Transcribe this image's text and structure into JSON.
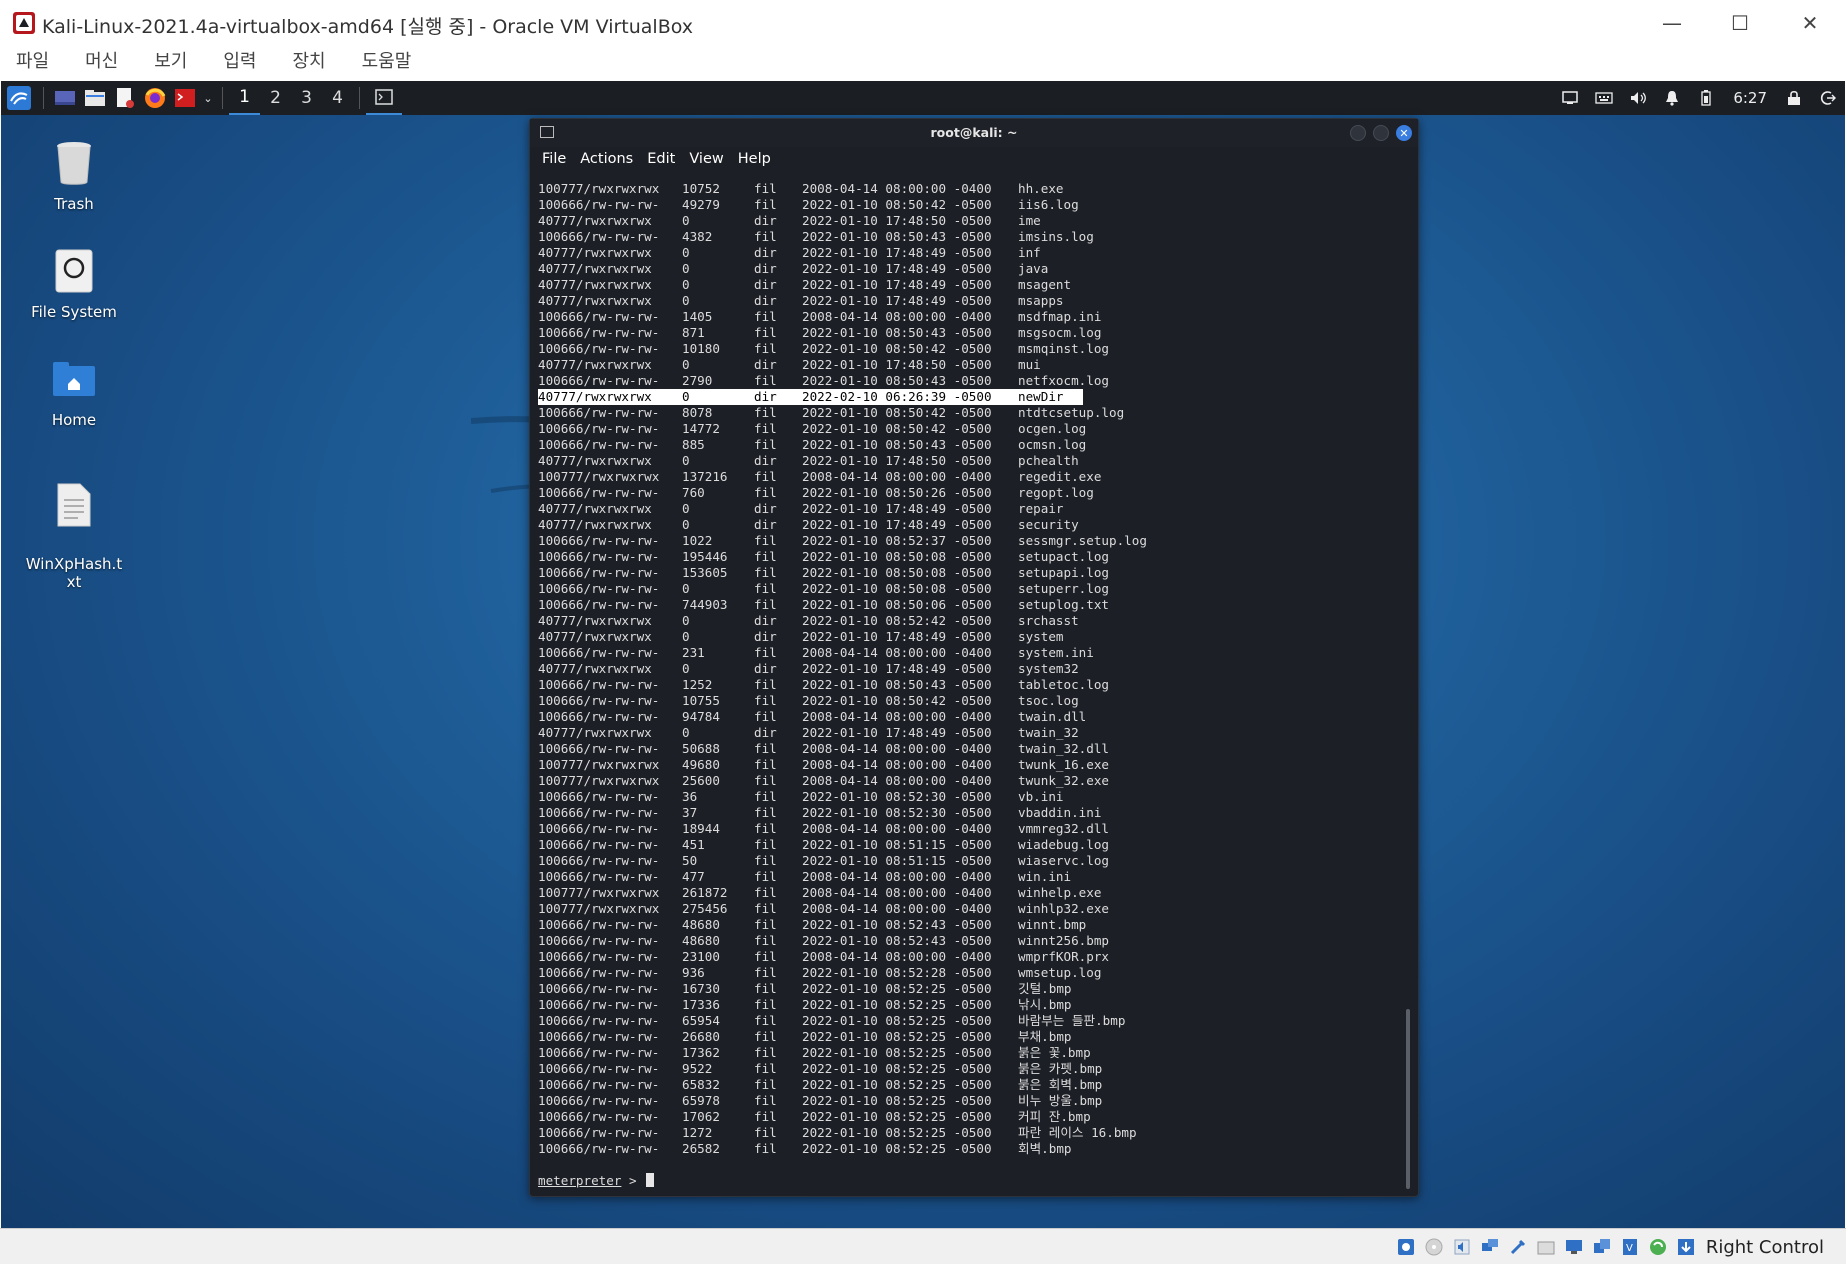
{
  "vbox": {
    "title": "Kali-Linux-2021.4a-virtualbox-amd64 [실행 중] - Oracle VM VirtualBox",
    "menu": [
      "파일",
      "머신",
      "보기",
      "입력",
      "장치",
      "도움말"
    ],
    "host_key": "Right Control"
  },
  "panel": {
    "workspaces": [
      "1",
      "2",
      "3",
      "4"
    ],
    "clock": "6:27"
  },
  "desktop": {
    "icons": [
      {
        "label": "Trash"
      },
      {
        "label": "File System"
      },
      {
        "label": "Home"
      },
      {
        "label": "WinXpHash.t\nxt"
      }
    ]
  },
  "terminal": {
    "title": "root@kali: ~",
    "menu": [
      "File",
      "Actions",
      "Edit",
      "View",
      "Help"
    ],
    "prompt": "meterpreter",
    "prompt_suffix": " > ",
    "highlighted_row": 13,
    "rows": [
      [
        "100777/rwxrwxrwx",
        "10752",
        "fil",
        "2008-04-14 08:00:00 -0400",
        "hh.exe"
      ],
      [
        "100666/rw-rw-rw-",
        "49279",
        "fil",
        "2022-01-10 08:50:42 -0500",
        "iis6.log"
      ],
      [
        "40777/rwxrwxrwx",
        "0",
        "dir",
        "2022-01-10 17:48:50 -0500",
        "ime"
      ],
      [
        "100666/rw-rw-rw-",
        "4382",
        "fil",
        "2022-01-10 08:50:43 -0500",
        "imsins.log"
      ],
      [
        "40777/rwxrwxrwx",
        "0",
        "dir",
        "2022-01-10 17:48:49 -0500",
        "inf"
      ],
      [
        "40777/rwxrwxrwx",
        "0",
        "dir",
        "2022-01-10 17:48:49 -0500",
        "java"
      ],
      [
        "40777/rwxrwxrwx",
        "0",
        "dir",
        "2022-01-10 17:48:49 -0500",
        "msagent"
      ],
      [
        "40777/rwxrwxrwx",
        "0",
        "dir",
        "2022-01-10 17:48:49 -0500",
        "msapps"
      ],
      [
        "100666/rw-rw-rw-",
        "1405",
        "fil",
        "2008-04-14 08:00:00 -0400",
        "msdfmap.ini"
      ],
      [
        "100666/rw-rw-rw-",
        "871",
        "fil",
        "2022-01-10 08:50:43 -0500",
        "msgsocm.log"
      ],
      [
        "100666/rw-rw-rw-",
        "10180",
        "fil",
        "2022-01-10 08:50:42 -0500",
        "msmqinst.log"
      ],
      [
        "40777/rwxrwxrwx",
        "0",
        "dir",
        "2022-01-10 17:48:50 -0500",
        "mui"
      ],
      [
        "100666/rw-rw-rw-",
        "2790",
        "fil",
        "2022-01-10 08:50:43 -0500",
        "netfxocm.log"
      ],
      [
        "40777/rwxrwxrwx",
        "0",
        "dir",
        "2022-02-10 06:26:39 -0500",
        "newDir"
      ],
      [
        "100666/rw-rw-rw-",
        "8078",
        "fil",
        "2022-01-10 08:50:42 -0500",
        "ntdtcsetup.log"
      ],
      [
        "100666/rw-rw-rw-",
        "14772",
        "fil",
        "2022-01-10 08:50:42 -0500",
        "ocgen.log"
      ],
      [
        "100666/rw-rw-rw-",
        "885",
        "fil",
        "2022-01-10 08:50:43 -0500",
        "ocmsn.log"
      ],
      [
        "40777/rwxrwxrwx",
        "0",
        "dir",
        "2022-01-10 17:48:50 -0500",
        "pchealth"
      ],
      [
        "100777/rwxrwxrwx",
        "137216",
        "fil",
        "2008-04-14 08:00:00 -0400",
        "regedit.exe"
      ],
      [
        "100666/rw-rw-rw-",
        "760",
        "fil",
        "2022-01-10 08:50:26 -0500",
        "regopt.log"
      ],
      [
        "40777/rwxrwxrwx",
        "0",
        "dir",
        "2022-01-10 17:48:49 -0500",
        "repair"
      ],
      [
        "40777/rwxrwxrwx",
        "0",
        "dir",
        "2022-01-10 17:48:49 -0500",
        "security"
      ],
      [
        "100666/rw-rw-rw-",
        "1022",
        "fil",
        "2022-01-10 08:52:37 -0500",
        "sessmgr.setup.log"
      ],
      [
        "100666/rw-rw-rw-",
        "195446",
        "fil",
        "2022-01-10 08:50:08 -0500",
        "setupact.log"
      ],
      [
        "100666/rw-rw-rw-",
        "153605",
        "fil",
        "2022-01-10 08:50:08 -0500",
        "setupapi.log"
      ],
      [
        "100666/rw-rw-rw-",
        "0",
        "fil",
        "2022-01-10 08:50:08 -0500",
        "setuperr.log"
      ],
      [
        "100666/rw-rw-rw-",
        "744903",
        "fil",
        "2022-01-10 08:50:06 -0500",
        "setuplog.txt"
      ],
      [
        "40777/rwxrwxrwx",
        "0",
        "dir",
        "2022-01-10 08:52:42 -0500",
        "srchasst"
      ],
      [
        "40777/rwxrwxrwx",
        "0",
        "dir",
        "2022-01-10 17:48:49 -0500",
        "system"
      ],
      [
        "100666/rw-rw-rw-",
        "231",
        "fil",
        "2008-04-14 08:00:00 -0400",
        "system.ini"
      ],
      [
        "40777/rwxrwxrwx",
        "0",
        "dir",
        "2022-01-10 17:48:49 -0500",
        "system32"
      ],
      [
        "100666/rw-rw-rw-",
        "1252",
        "fil",
        "2022-01-10 08:50:43 -0500",
        "tabletoc.log"
      ],
      [
        "100666/rw-rw-rw-",
        "10755",
        "fil",
        "2022-01-10 08:50:42 -0500",
        "tsoc.log"
      ],
      [
        "100666/rw-rw-rw-",
        "94784",
        "fil",
        "2008-04-14 08:00:00 -0400",
        "twain.dll"
      ],
      [
        "40777/rwxrwxrwx",
        "0",
        "dir",
        "2022-01-10 17:48:49 -0500",
        "twain_32"
      ],
      [
        "100666/rw-rw-rw-",
        "50688",
        "fil",
        "2008-04-14 08:00:00 -0400",
        "twain_32.dll"
      ],
      [
        "100777/rwxrwxrwx",
        "49680",
        "fil",
        "2008-04-14 08:00:00 -0400",
        "twunk_16.exe"
      ],
      [
        "100777/rwxrwxrwx",
        "25600",
        "fil",
        "2008-04-14 08:00:00 -0400",
        "twunk_32.exe"
      ],
      [
        "100666/rw-rw-rw-",
        "36",
        "fil",
        "2022-01-10 08:52:30 -0500",
        "vb.ini"
      ],
      [
        "100666/rw-rw-rw-",
        "37",
        "fil",
        "2022-01-10 08:52:30 -0500",
        "vbaddin.ini"
      ],
      [
        "100666/rw-rw-rw-",
        "18944",
        "fil",
        "2008-04-14 08:00:00 -0400",
        "vmmreg32.dll"
      ],
      [
        "100666/rw-rw-rw-",
        "451",
        "fil",
        "2022-01-10 08:51:15 -0500",
        "wiadebug.log"
      ],
      [
        "100666/rw-rw-rw-",
        "50",
        "fil",
        "2022-01-10 08:51:15 -0500",
        "wiaservc.log"
      ],
      [
        "100666/rw-rw-rw-",
        "477",
        "fil",
        "2008-04-14 08:00:00 -0400",
        "win.ini"
      ],
      [
        "100777/rwxrwxrwx",
        "261872",
        "fil",
        "2008-04-14 08:00:00 -0400",
        "winhelp.exe"
      ],
      [
        "100777/rwxrwxrwx",
        "275456",
        "fil",
        "2008-04-14 08:00:00 -0400",
        "winhlp32.exe"
      ],
      [
        "100666/rw-rw-rw-",
        "48680",
        "fil",
        "2022-01-10 08:52:43 -0500",
        "winnt.bmp"
      ],
      [
        "100666/rw-rw-rw-",
        "48680",
        "fil",
        "2022-01-10 08:52:43 -0500",
        "winnt256.bmp"
      ],
      [
        "100666/rw-rw-rw-",
        "23100",
        "fil",
        "2008-04-14 08:00:00 -0400",
        "wmprfKOR.prx"
      ],
      [
        "100666/rw-rw-rw-",
        "936",
        "fil",
        "2022-01-10 08:52:28 -0500",
        "wmsetup.log"
      ],
      [
        "100666/rw-rw-rw-",
        "16730",
        "fil",
        "2022-01-10 08:52:25 -0500",
        "깃털.bmp"
      ],
      [
        "100666/rw-rw-rw-",
        "17336",
        "fil",
        "2022-01-10 08:52:25 -0500",
        "낚시.bmp"
      ],
      [
        "100666/rw-rw-rw-",
        "65954",
        "fil",
        "2022-01-10 08:52:25 -0500",
        "바람부는 들판.bmp"
      ],
      [
        "100666/rw-rw-rw-",
        "26680",
        "fil",
        "2022-01-10 08:52:25 -0500",
        "부채.bmp"
      ],
      [
        "100666/rw-rw-rw-",
        "17362",
        "fil",
        "2022-01-10 08:52:25 -0500",
        "붉은 꽃.bmp"
      ],
      [
        "100666/rw-rw-rw-",
        "9522",
        "fil",
        "2022-01-10 08:52:25 -0500",
        "붉은 카펫.bmp"
      ],
      [
        "100666/rw-rw-rw-",
        "65832",
        "fil",
        "2022-01-10 08:52:25 -0500",
        "붉은 회벽.bmp"
      ],
      [
        "100666/rw-rw-rw-",
        "65978",
        "fil",
        "2022-01-10 08:52:25 -0500",
        "비누 방울.bmp"
      ],
      [
        "100666/rw-rw-rw-",
        "17062",
        "fil",
        "2022-01-10 08:52:25 -0500",
        "커피 잔.bmp"
      ],
      [
        "100666/rw-rw-rw-",
        "1272",
        "fil",
        "2022-01-10 08:52:25 -0500",
        "파란 레이스 16.bmp"
      ],
      [
        "100666/rw-rw-rw-",
        "26582",
        "fil",
        "2022-01-10 08:52:25 -0500",
        "회벽.bmp"
      ]
    ]
  }
}
